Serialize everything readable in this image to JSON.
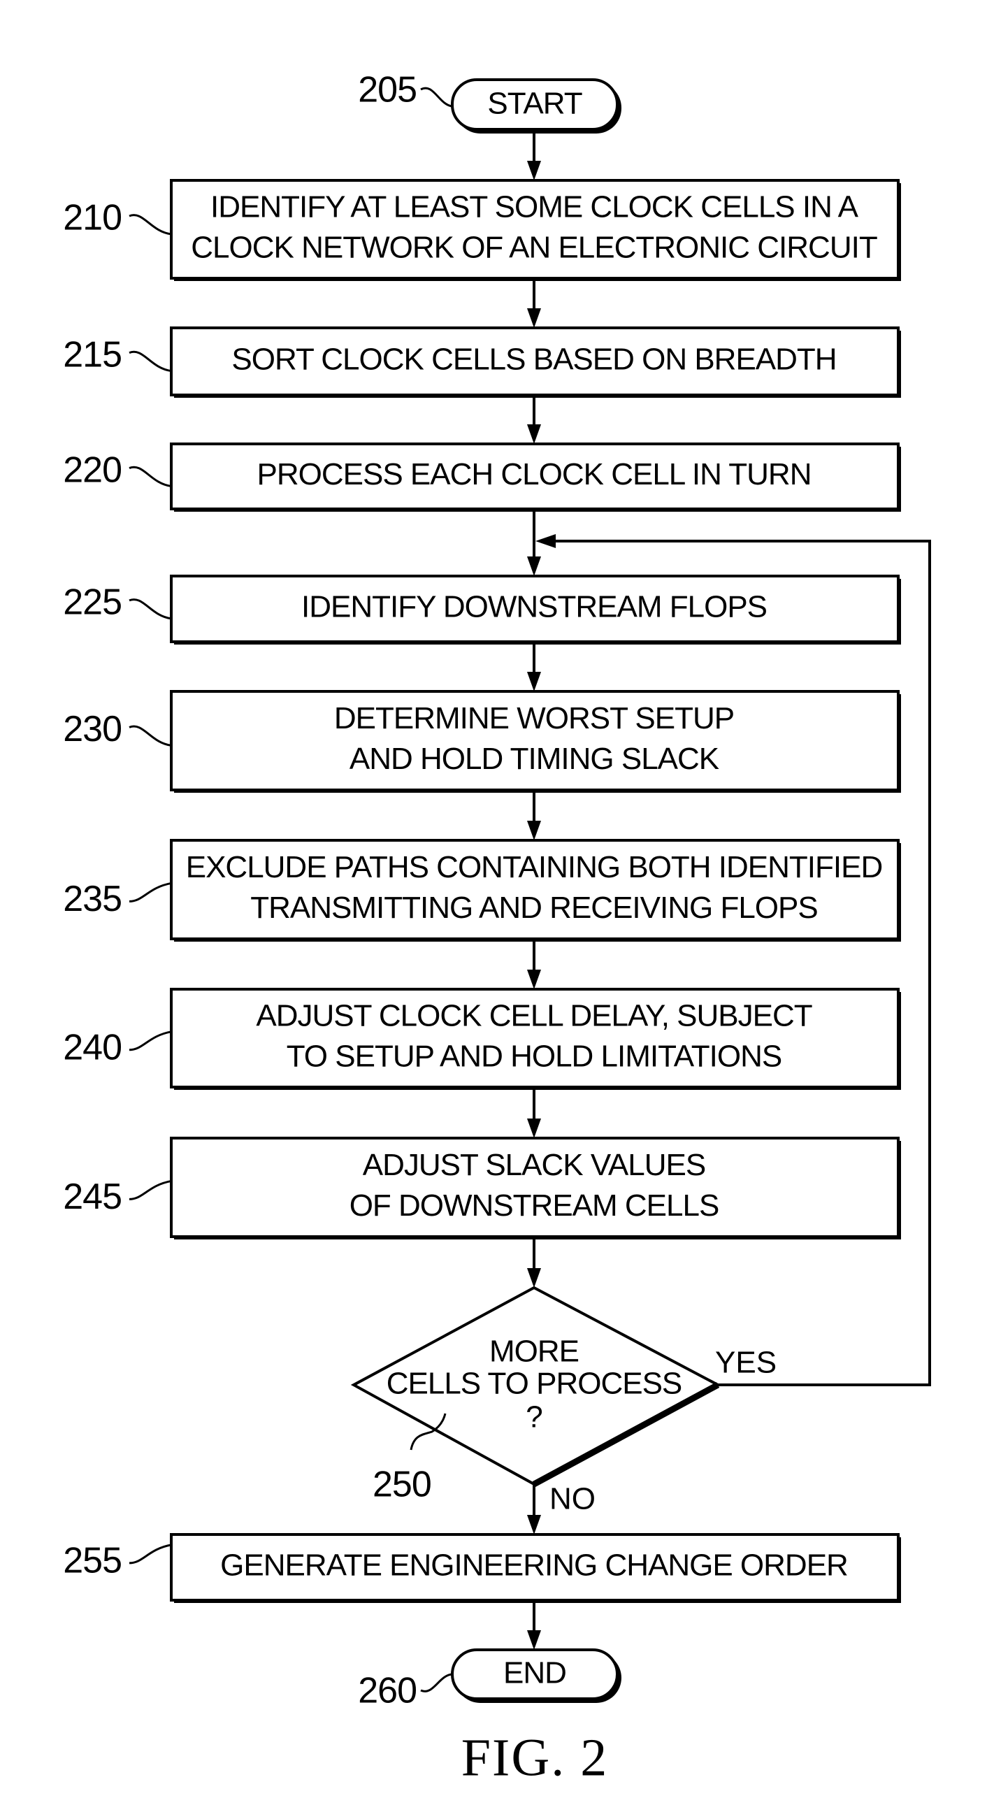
{
  "figure": {
    "caption": "FIG. 2",
    "start": {
      "ref": "205",
      "label": "START"
    },
    "end": {
      "ref": "260",
      "label": "END"
    },
    "steps": [
      {
        "ref": "210",
        "lines": [
          "IDENTIFY AT LEAST SOME CLOCK CELLS IN A",
          "CLOCK NETWORK OF AN ELECTRONIC CIRCUIT"
        ]
      },
      {
        "ref": "215",
        "lines": [
          "SORT CLOCK CELLS BASED ON BREADTH"
        ]
      },
      {
        "ref": "220",
        "lines": [
          "PROCESS EACH CLOCK CELL IN TURN"
        ]
      },
      {
        "ref": "225",
        "lines": [
          "IDENTIFY DOWNSTREAM FLOPS"
        ]
      },
      {
        "ref": "230",
        "lines": [
          "DETERMINE WORST SETUP",
          "AND HOLD TIMING SLACK"
        ]
      },
      {
        "ref": "235",
        "lines": [
          "EXCLUDE PATHS CONTAINING BOTH IDENTIFIED",
          "TRANSMITTING AND RECEIVING FLOPS"
        ]
      },
      {
        "ref": "240",
        "lines": [
          "ADJUST CLOCK CELL DELAY, SUBJECT",
          "TO SETUP AND HOLD LIMITATIONS"
        ]
      },
      {
        "ref": "245",
        "lines": [
          "ADJUST SLACK VALUES",
          "OF DOWNSTREAM CELLS"
        ]
      },
      {
        "ref": "255",
        "lines": [
          "GENERATE ENGINEERING CHANGE ORDER"
        ]
      }
    ],
    "decision": {
      "ref": "250",
      "lines": [
        "MORE",
        "CELLS TO PROCESS",
        "?"
      ],
      "yes_label": "YES",
      "no_label": "NO"
    }
  }
}
